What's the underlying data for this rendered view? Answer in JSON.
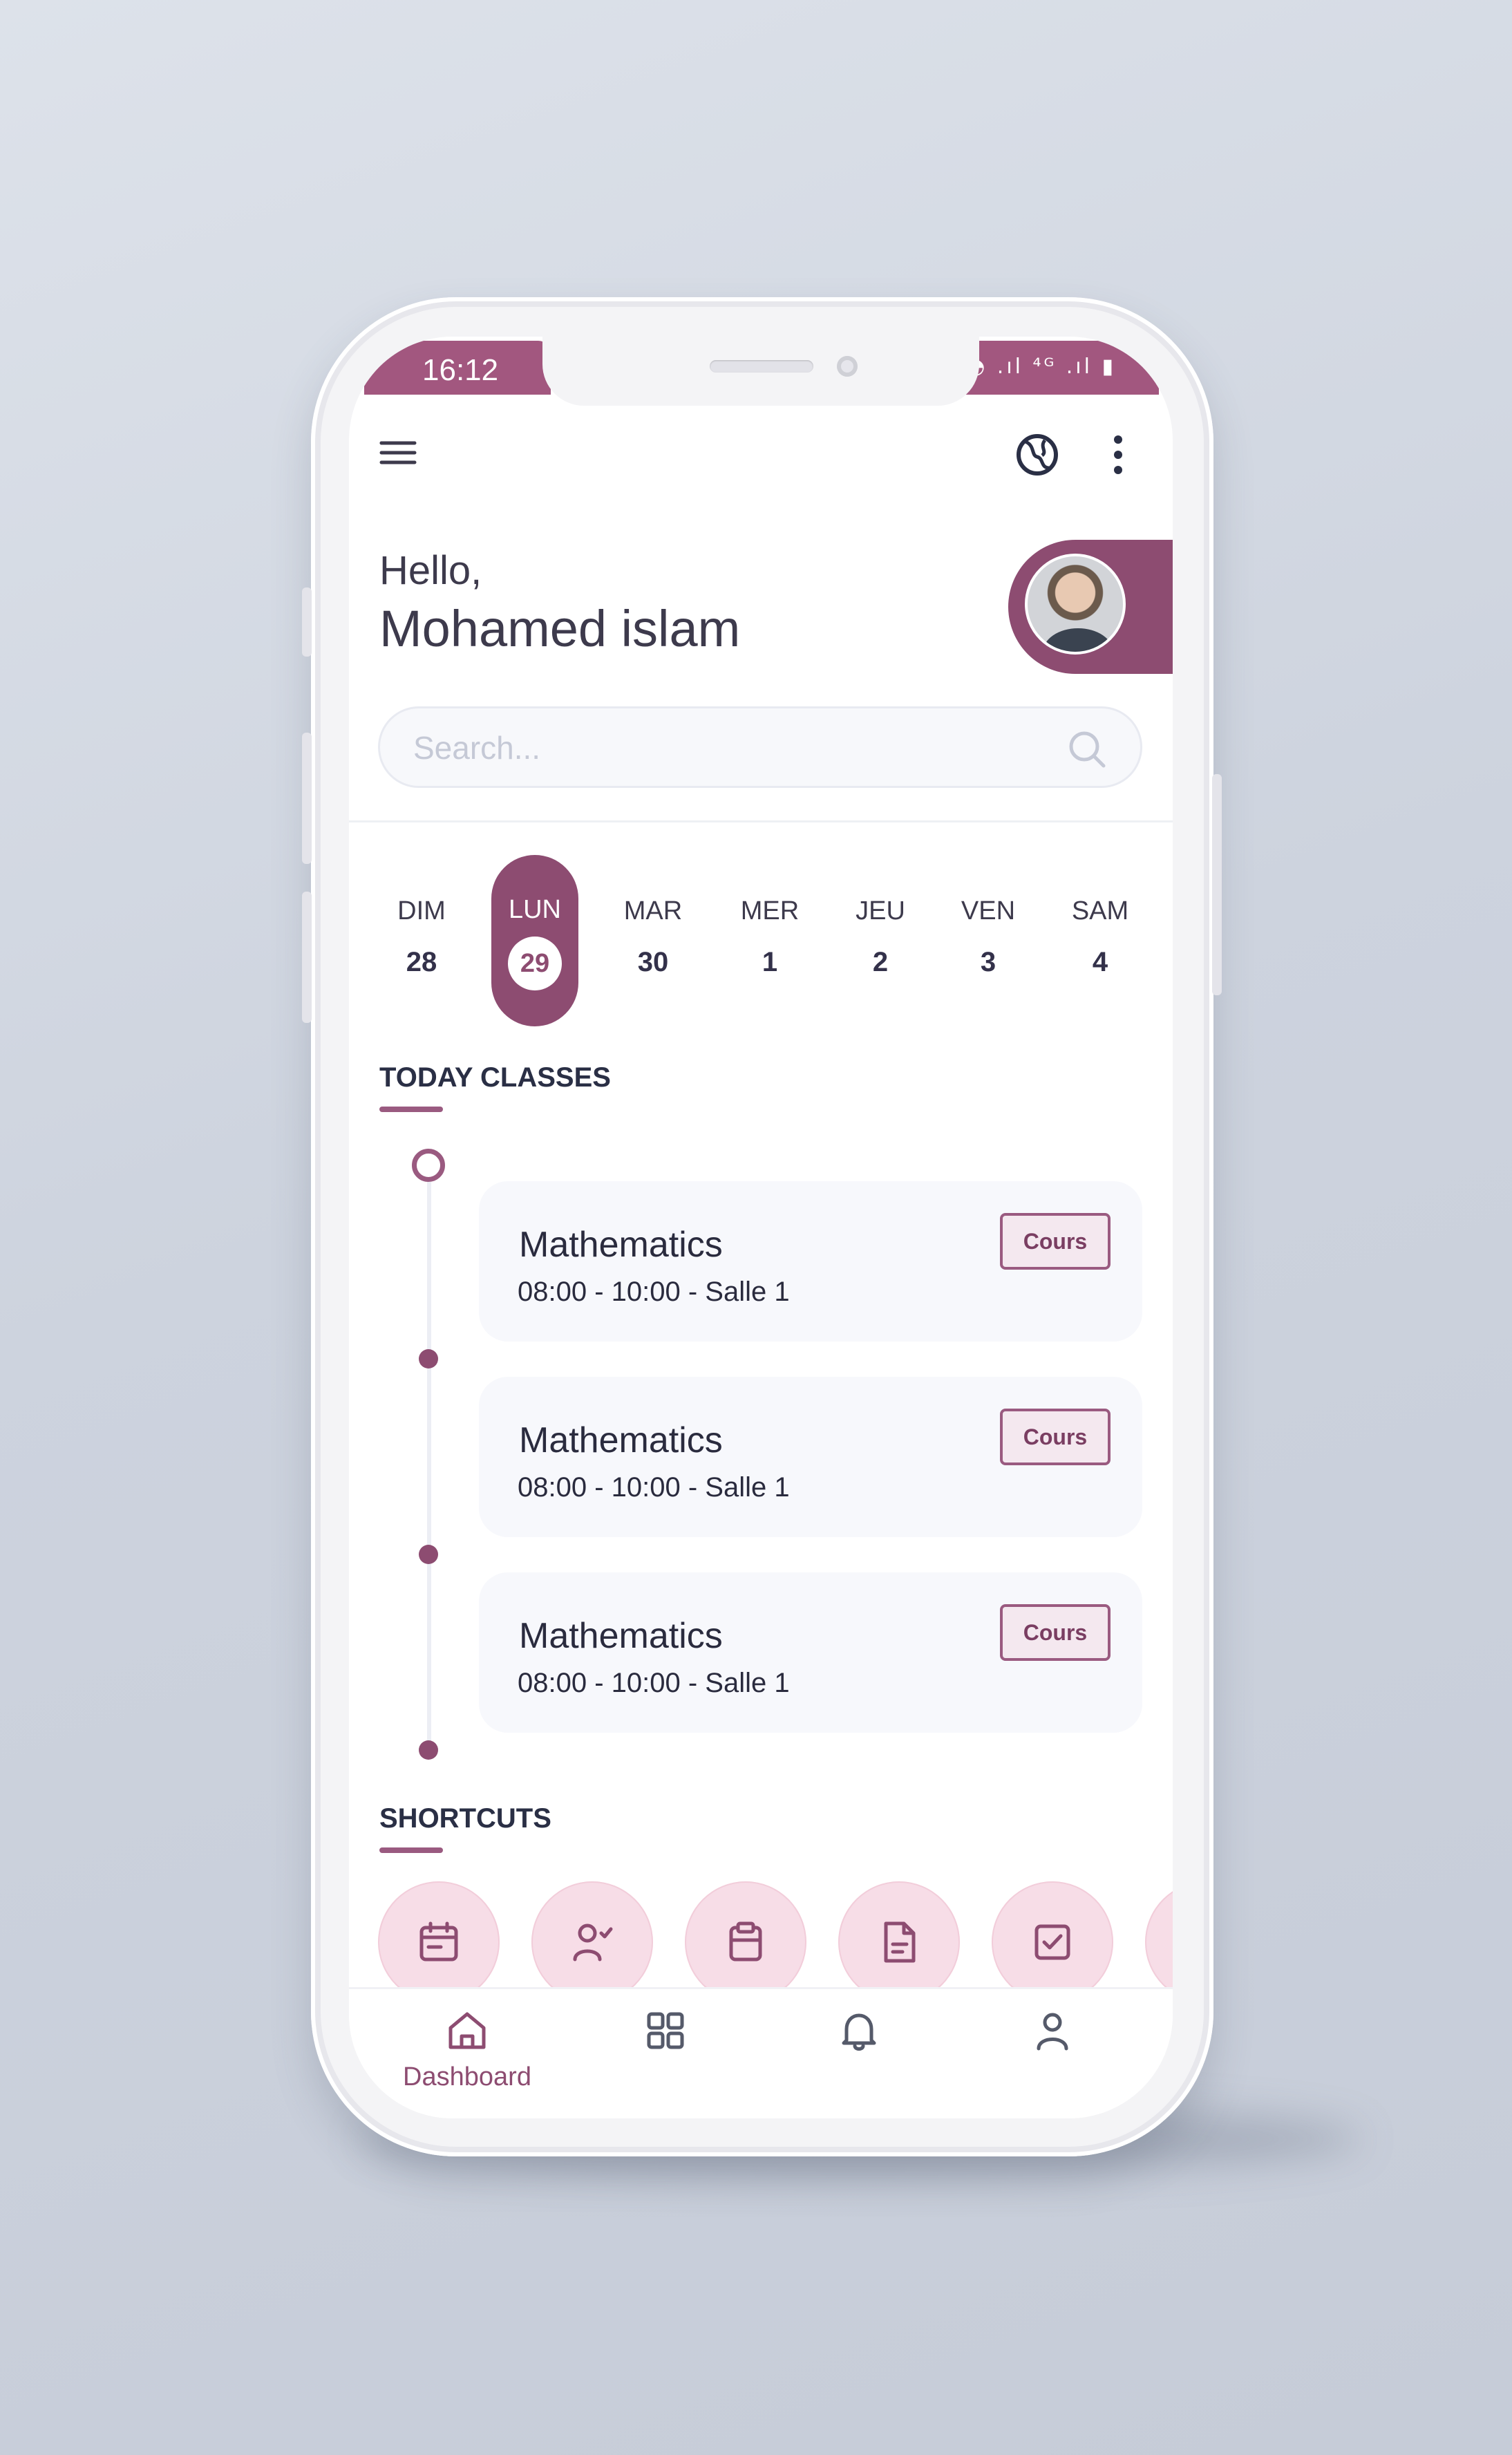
{
  "status_bar": {
    "time": "16:12",
    "signal_text": "◔ .ıl ⁴ᴳ .ıl ▮"
  },
  "header": {
    "menu_icon": "menu-lines-icon",
    "theme_icon": "globe-icon",
    "more_icon": "vertical-dots-icon"
  },
  "greeting": {
    "hello": "Hello,",
    "name": "Mohamed islam"
  },
  "search": {
    "placeholder": "Search..."
  },
  "week": {
    "days": [
      {
        "name": "DIM",
        "num": "28"
      },
      {
        "name": "LUN",
        "num": "29",
        "selected": true
      },
      {
        "name": "MAR",
        "num": "30"
      },
      {
        "name": "MER",
        "num": "1"
      },
      {
        "name": "JEU",
        "num": "2"
      },
      {
        "name": "VEN",
        "num": "3"
      },
      {
        "name": "SAM",
        "num": "4"
      }
    ]
  },
  "today_classes": {
    "title": "TODAY CLASSES",
    "items": [
      {
        "subject": "Mathematics",
        "details": "08:00 - 10:00 - Salle 1",
        "badge": "Cours"
      },
      {
        "subject": "Mathematics",
        "details": "08:00 - 10:00 - Salle 1",
        "badge": "Cours"
      },
      {
        "subject": "Mathematics",
        "details": "08:00 - 10:00 - Salle 1",
        "badge": "Cours"
      }
    ]
  },
  "shortcuts": {
    "title": "SHORTCUTS",
    "icons": [
      "calendar-icon",
      "user-check-icon",
      "clipboard-icon",
      "document-icon",
      "checkbox-icon"
    ]
  },
  "bottom_nav": {
    "items": [
      {
        "label": "Dashboard",
        "icon": "home-icon",
        "active": true
      },
      {
        "label": "",
        "icon": "grid-icon"
      },
      {
        "label": "",
        "icon": "bell-icon"
      },
      {
        "label": "",
        "icon": "user-icon"
      }
    ]
  },
  "colors": {
    "accent": "#8d4c71",
    "accent_light": "#f7dde7",
    "text": "#2a2f45"
  }
}
